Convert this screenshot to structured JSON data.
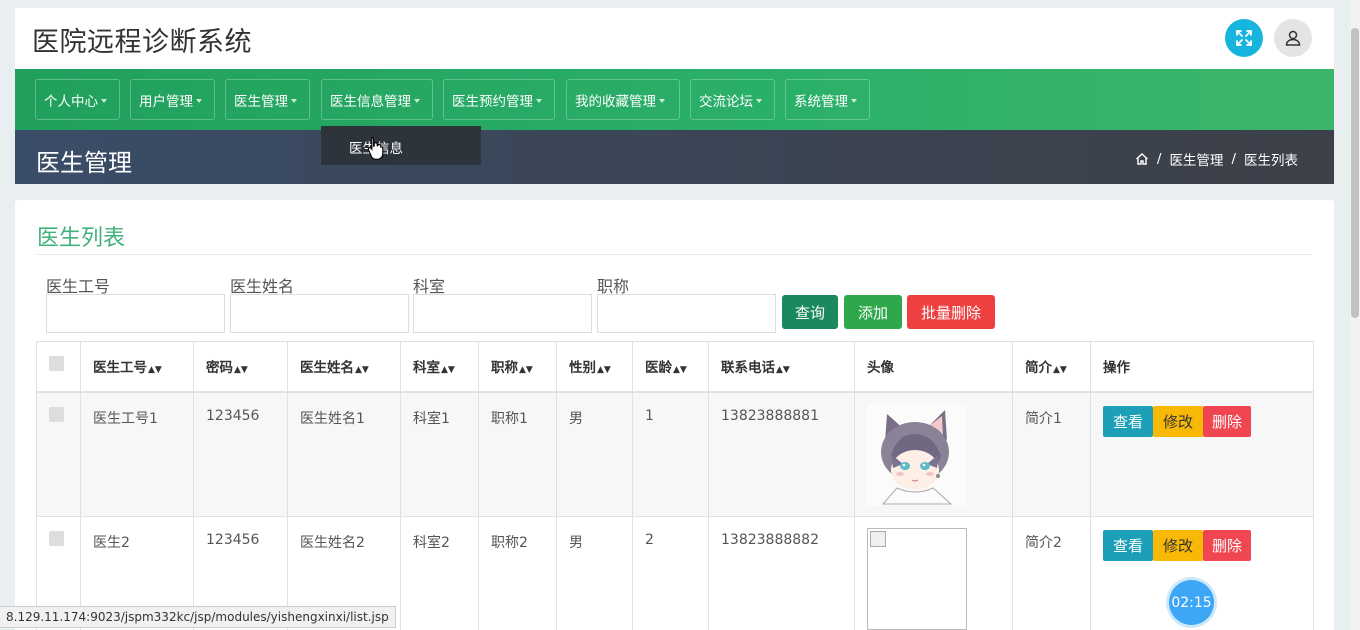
{
  "app": {
    "title": "医院远程诊断系统"
  },
  "topbar": {
    "fullscreen_icon": "fullscreen-icon",
    "user_icon": "user-icon"
  },
  "nav": {
    "items": [
      {
        "label": "个人中心"
      },
      {
        "label": "用户管理"
      },
      {
        "label": "医生管理"
      },
      {
        "label": "医生信息管理"
      },
      {
        "label": "医生预约管理"
      },
      {
        "label": "我的收藏管理"
      },
      {
        "label": "交流论坛"
      },
      {
        "label": "系统管理"
      }
    ],
    "dropdown": {
      "item": "医生信息"
    }
  },
  "header": {
    "title": "医生管理",
    "breadcrumb": [
      "医生管理",
      "医生列表"
    ]
  },
  "card": {
    "title": "医生列表",
    "search": {
      "fields": [
        {
          "label": "医生工号",
          "value": ""
        },
        {
          "label": "医生姓名",
          "value": ""
        },
        {
          "label": "科室",
          "value": ""
        },
        {
          "label": "职称",
          "value": ""
        }
      ],
      "query_label": "查询",
      "add_label": "添加",
      "batch_delete_label": "批量删除"
    },
    "table": {
      "columns": [
        "医生工号",
        "密码",
        "医生姓名",
        "科室",
        "职称",
        "性别",
        "医龄",
        "联系电话",
        "头像",
        "简介",
        "操作"
      ],
      "rows": [
        {
          "id": "医生工号1",
          "password": "123456",
          "name": "医生姓名1",
          "dept": "科室1",
          "title": "职称1",
          "gender": "男",
          "years": "1",
          "phone": "13823888881",
          "intro": "简介1"
        },
        {
          "id": "医生2",
          "password": "123456",
          "name": "医生姓名2",
          "dept": "科室2",
          "title": "职称2",
          "gender": "男",
          "years": "2",
          "phone": "13823888882",
          "intro": "简介2"
        }
      ],
      "actions": {
        "view": "查看",
        "edit": "修改",
        "delete": "删除"
      }
    }
  },
  "timer": "02:15",
  "status_url": "8.129.11.174:9023/jspm332kc/jsp/modules/yishengxinxi/list.jsp",
  "colors": {
    "nav_green": "#2bb06a",
    "title_green": "#42b27a",
    "header_dark": "#3b475a"
  }
}
